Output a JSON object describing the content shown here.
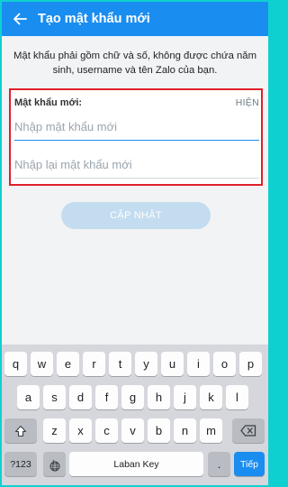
{
  "header": {
    "title": "Tạo mật khẩu mới",
    "bg_color": "#1a8df0"
  },
  "instructions": "Mật khẩu phải gồm chữ và số, không được chứa năm sinh, username và tên Zalo của bạn.",
  "form": {
    "label": "Mật khẩu mới:",
    "show_label": "HIỆN",
    "new_password_placeholder": "Nhập mật khẩu mới",
    "confirm_password_placeholder": "Nhập lại mật khẩu mới",
    "highlight_color": "#e0202a"
  },
  "update_button": "CẬP NHẬT",
  "keyboard": {
    "row1": [
      "q",
      "w",
      "e",
      "r",
      "t",
      "y",
      "u",
      "i",
      "o",
      "p"
    ],
    "row2": [
      "a",
      "s",
      "d",
      "f",
      "g",
      "h",
      "j",
      "k",
      "l"
    ],
    "row3": [
      "z",
      "x",
      "c",
      "v",
      "b",
      "n",
      "m"
    ],
    "symbols_key": "?123",
    "comma_key": ",",
    "space_key": "Laban Key",
    "period_key": ".",
    "action_key": "Tiếp"
  }
}
